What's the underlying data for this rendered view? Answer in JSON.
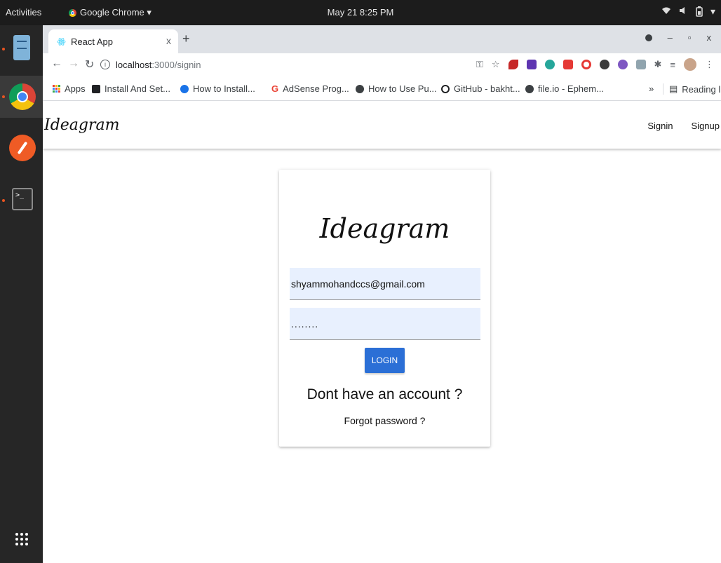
{
  "topbar": {
    "activities": "Activities",
    "app_menu": "Google Chrome ▾",
    "clock": "May 21  8:25 PM"
  },
  "browser": {
    "tab_title": "React App",
    "tab_close": "x",
    "new_tab": "+",
    "url_host": "localhost",
    "url_path": ":3000/signin",
    "bookmarks": [
      {
        "label": "Apps",
        "icon": "apps-grid-icon",
        "color": "#4285f4"
      },
      {
        "label": "Install And Set...",
        "icon": "video-icon",
        "color": "#202124"
      },
      {
        "label": "How to Install...",
        "icon": "site-icon",
        "color": "#1a73e8"
      },
      {
        "label": "AdSense Prog...",
        "icon": "google-icon",
        "color": "#ea4335"
      },
      {
        "label": "How to Use Pu...",
        "icon": "globe-icon",
        "color": "#3c4043"
      },
      {
        "label": "GitHub - bakht...",
        "icon": "github-icon",
        "color": "#202124"
      },
      {
        "label": "file.io - Ephem...",
        "icon": "globe-icon",
        "color": "#3c4043"
      }
    ],
    "bookmarks_more": "»",
    "reading_list": "Reading list"
  },
  "app": {
    "brand": "Ideagram",
    "nav": {
      "signin": "Signin",
      "signup": "Signup"
    }
  },
  "signin_card": {
    "title": "Ideagram",
    "email_value": "shyammohandccs@gmail.com",
    "password_value": "........",
    "login_label": "LOGIN",
    "signup_prompt": "Dont have an account ?",
    "forgot_label": "Forgot password ?"
  },
  "colors": {
    "login_button": "#2b6fd6",
    "autofill_bg": "#e8f0fe",
    "tabstrip_bg": "#dee1e6",
    "topbar_bg": "#1c1c1c"
  }
}
